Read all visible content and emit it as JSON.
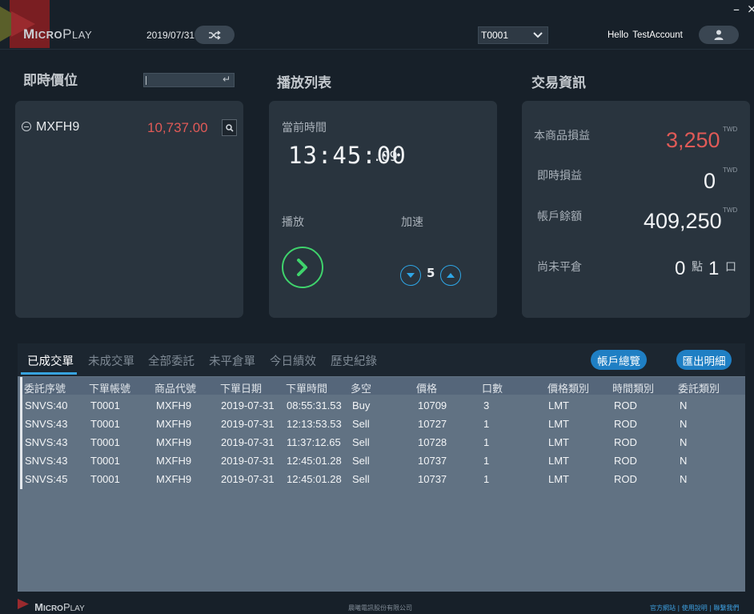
{
  "app": {
    "logo_micro": "Micro",
    "logo_play": "Play",
    "date": "2019/07/31",
    "account_selected": "T0001",
    "hello": "Hello",
    "username": "TestAccount"
  },
  "realtime": {
    "title": "即時價位",
    "items": [
      {
        "symbol": "MXFH9",
        "price": "10,737.00"
      }
    ]
  },
  "playlist": {
    "title": "播放列表",
    "current_time_label": "當前時間",
    "clock": "13:45:00",
    "clock_ms": ".09",
    "play_label": "播放",
    "speed_label": "加速",
    "speed_value": "5"
  },
  "trade_info": {
    "title": "交易資訊",
    "pnl_label": "本商品損益",
    "pnl_value": "3,250",
    "realtime_pnl_label": "即時損益",
    "realtime_pnl_value": "0",
    "balance_label": "帳戶餘額",
    "balance_value": "409,250",
    "currency": "TWD",
    "open_pos_label": "尚未平倉",
    "open_points": "0",
    "points_unit": "點",
    "open_lots": "1",
    "lots_unit": "口"
  },
  "tabs": [
    "已成交單",
    "未成交單",
    "全部委託",
    "未平倉單",
    "今日績效",
    "歷史紀錄"
  ],
  "buttons": {
    "account_overview": "帳戶總覽",
    "export_details": "匯出明細"
  },
  "table": {
    "columns": [
      "委託序號",
      "下單帳號",
      "商品代號",
      "下單日期",
      "下單時間",
      "多空",
      "價格",
      "口數",
      "價格類別",
      "時間類別",
      "委託類別"
    ],
    "rows": [
      [
        "SNVS:40",
        "T0001",
        "MXFH9",
        "2019-07-31",
        "08:55:31.53",
        "Buy",
        "10709",
        "3",
        "LMT",
        "ROD",
        "N"
      ],
      [
        "SNVS:43",
        "T0001",
        "MXFH9",
        "2019-07-31",
        "12:13:53.53",
        "Sell",
        "10727",
        "1",
        "LMT",
        "ROD",
        "N"
      ],
      [
        "SNVS:43",
        "T0001",
        "MXFH9",
        "2019-07-31",
        "11:37:12.65",
        "Sell",
        "10728",
        "1",
        "LMT",
        "ROD",
        "N"
      ],
      [
        "SNVS:43",
        "T0001",
        "MXFH9",
        "2019-07-31",
        "12:45:01.28",
        "Sell",
        "10737",
        "1",
        "LMT",
        "ROD",
        "N"
      ],
      [
        "SNVS:45",
        "T0001",
        "MXFH9",
        "2019-07-31",
        "12:45:01.28",
        "Sell",
        "10737",
        "1",
        "LMT",
        "ROD",
        "N"
      ]
    ]
  },
  "footer": {
    "logo_micro": "Micro",
    "logo_play": "Play",
    "copyright": "晨曦電訊股份有限公司",
    "links": "官方網站 | 使用說明 | 聯繫我們"
  },
  "colors": {
    "accent_blue": "#1f7fc4",
    "loss_red": "#e05a57",
    "play_green": "#3fd36c",
    "panel_bg": "#29343e"
  }
}
